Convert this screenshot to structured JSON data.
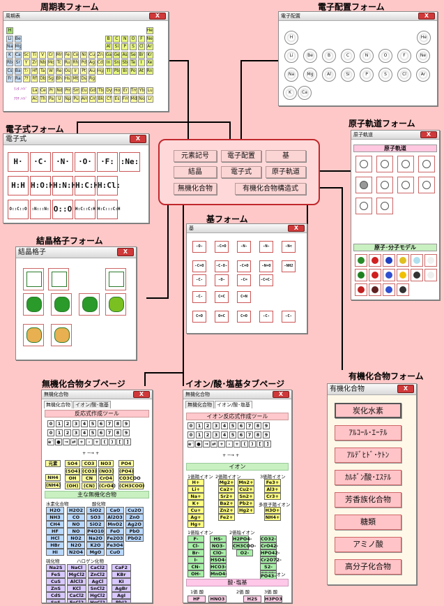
{
  "captions": {
    "periodic": "周期表フォーム",
    "econfig": "電子配置フォーム",
    "dot": "電子式フォーム",
    "orbital": "原子軌道フォーム",
    "crystal": "結晶格子フォーム",
    "group": "基フォーム",
    "inorganic": "無機化合物タブページ",
    "ion": "イオン/酸･塩基タブページ",
    "organic": "有機化合物フォーム"
  },
  "windows": {
    "periodic": "周期表",
    "econfig": "電子配置",
    "dot": "電子式",
    "orbital": "原子軌道",
    "crystal": "結晶格子",
    "group": "基",
    "inorganic": "無機化合物",
    "ion": "無機化合物",
    "organic": "有機化合物"
  },
  "close_label": "X",
  "hub": {
    "b1": "元素記号",
    "b2": "電子配置",
    "b3": "基",
    "b4": "結晶",
    "b5": "電子式",
    "b6": "原子軌道",
    "b7": "無機化合物",
    "b8": "有機化合物構造式"
  },
  "periodic": {
    "row1": [
      "H",
      "",
      "",
      "",
      "",
      "",
      "",
      "",
      "",
      "",
      "",
      "",
      "",
      "",
      "",
      "",
      "",
      "He"
    ],
    "row2": [
      "Li",
      "Be",
      "",
      "",
      "",
      "",
      "",
      "",
      "",
      "",
      "",
      "",
      "B",
      "C",
      "N",
      "O",
      "F",
      "Ne"
    ],
    "row3": [
      "Na",
      "Mg",
      "",
      "",
      "",
      "",
      "",
      "",
      "",
      "",
      "",
      "",
      "Al",
      "Si",
      "P",
      "S",
      "Cl",
      "Ar"
    ],
    "row4": [
      "K",
      "Ca",
      "Sc",
      "Ti",
      "V",
      "Cr",
      "Mn",
      "Fe",
      "Co",
      "Ni",
      "Cu",
      "Zn",
      "Ga",
      "Ge",
      "As",
      "Se",
      "Br",
      "Kr"
    ],
    "row5": [
      "Rb",
      "Sr",
      "Y",
      "Zr",
      "Nb",
      "Mo",
      "Tc",
      "Ru",
      "Rh",
      "Pd",
      "Ag",
      "Cd",
      "In",
      "Sn",
      "Sb",
      "Te",
      "I",
      "Xe"
    ],
    "row6": [
      "Cs",
      "Ba",
      "ﾗﾝﾀﾉｲﾄﾞ",
      "Hf",
      "Ta",
      "W",
      "Re",
      "Os",
      "Ir",
      "Pt",
      "Au",
      "Hg",
      "Tl",
      "Pb",
      "Bi",
      "Po",
      "At",
      "Rn"
    ],
    "row7": [
      "Fr",
      "Ra",
      "ｱｸﾁﾉｲﾄﾞ",
      "Rf",
      "Db",
      "Sg",
      "Bh",
      "Hs",
      "Mt",
      "Ds",
      "Rg",
      "",
      "",
      "",
      "",
      "",
      "",
      ""
    ],
    "lan": [
      "La",
      "Ce",
      "Pr",
      "Nd",
      "Pm",
      "Sm",
      "Eu",
      "Gd",
      "Tb",
      "Dy",
      "Ho",
      "Er",
      "Tm",
      "Yb",
      "Lu"
    ],
    "act": [
      "Ac",
      "Th",
      "Pa",
      "U",
      "Np",
      "Pu",
      "Am",
      "Cm",
      "Bk",
      "Cf",
      "Es",
      "Fm",
      "Md",
      "No",
      "Lr"
    ],
    "lan_label": "ﾗﾝﾀ\nﾉｲﾄﾞ",
    "act_label": "ｱｸﾁ\nﾉｲﾄﾞ"
  },
  "econfig": {
    "row1": [
      "H",
      "He"
    ],
    "row2": [
      "Li",
      "Be",
      "B",
      "C",
      "N",
      "O",
      "F",
      "Ne"
    ],
    "row3": [
      "Na",
      "Mg",
      "Al",
      "Si",
      "P",
      "S",
      "Cl",
      "Ar"
    ],
    "row4": [
      "K",
      "Ca"
    ]
  },
  "dot": {
    "r1": [
      "H·",
      "·C·",
      "·N·",
      "·O·",
      "·F:",
      ":Ne:"
    ],
    "r2": [
      "H:H",
      "H:O:H",
      "H:N:H",
      "H:C:H",
      "H:Cl:",
      ""
    ],
    "r3": [
      "O::C::O",
      ":N:::N:",
      "O::O",
      "H:C::C:H",
      "H:C:::C:H",
      ""
    ]
  },
  "orbital": {
    "sec1": "原子軌道",
    "sec2": "原子･分子モデル"
  },
  "group": {
    "r1": [
      "-O-",
      "-C=O",
      "-N-",
      "-N-",
      "-N<"
    ],
    "r2": [
      "-C=O",
      "-C-O-",
      "-C=O",
      "-N=O",
      "-NH2"
    ],
    "r3": [
      "-C-",
      "-O-",
      "-C=",
      "-C=C-",
      ""
    ],
    "r4": [
      "-C-",
      "C=C",
      "C=N",
      ""
    ],
    "r5": [
      "C=O",
      "O=C",
      "C=O",
      "-C-",
      "-C-"
    ]
  },
  "inorganic": {
    "tabs": [
      "無機化合物",
      "イオン/酸･塩基"
    ],
    "sec_tool": "反応式作成ツール",
    "digits": [
      "0",
      "1",
      "2",
      "3",
      "4",
      "5",
      "6",
      "7",
      "8",
      "9"
    ],
    "ops": [
      "e⁻",
      "●",
      "→",
      "⇄",
      "+",
      "-",
      "+",
      "(",
      ")",
      "[",
      "]"
    ],
    "arrow": "+ ─→ +",
    "blocks": [
      "元素",
      "SO4",
      "CO3",
      "NO3",
      "PO4",
      "(SO4)",
      "(CO3)",
      "(NO3)",
      "(PO4)",
      "NH4",
      "OH",
      "CN",
      "CrO4",
      "CO3COO",
      "(NH4)",
      "(OH)",
      "(CN)",
      "(CrO4)",
      "(CH3COO)"
    ],
    "sec_main": "主な無機化合物",
    "h_hyd": "水素化合物",
    "h_ox": "酸化物",
    "compounds_l": [
      "H2O",
      "NH3",
      "CH4",
      "HF",
      "HCl",
      "HBr",
      "HI"
    ],
    "compounds_m1": [
      "H2O2",
      "CO",
      "NO",
      "NO",
      "NO2",
      "N2O",
      "N2O4"
    ],
    "compounds_m2": [
      "SiO2",
      "SO3",
      "SiO2",
      "P4O10",
      "Na2O",
      "K2O",
      "MgO"
    ],
    "compounds_r1": [
      "CaO",
      "Al2O3",
      "MnO2",
      "FeO",
      "Fe2O3",
      "Fe3O4",
      "CuO"
    ],
    "compounds_r2": [
      "Cu2O",
      "ZnO",
      "Ag2O",
      "PbO",
      "PbO2",
      "",
      ""
    ],
    "h_sulf": "硫化物",
    "h_hal": "ハロゲン化物",
    "sulf": [
      "Na2S",
      "FeS",
      "CuS",
      "ZnS",
      "CdS",
      "SnS"
    ],
    "hal1": [
      "NaCl",
      "MgCl2",
      "AlCl3",
      "KCl",
      "CaCl2",
      "FeCl2"
    ],
    "hal2": [
      "CaCl2",
      "ZnCl2",
      "AgCl",
      "SnCl2",
      "HgCl2",
      "HgCl2"
    ],
    "hal3": [
      "CaF2",
      "KBr",
      "KI",
      "AgBr",
      "AgI",
      "PbI2"
    ]
  },
  "ion": {
    "tabs": [
      "無機化合物",
      "イオン/酸･塩基"
    ],
    "sec_tool": "イオン反応式作成ツール",
    "sec_ion": "イオン",
    "h1": "1価陽イオン",
    "h2": "2価陽イオン",
    "h3": "3価陽イオン",
    "c1": [
      "H+",
      "Li+",
      "Na+",
      "K+",
      "Cu+",
      "Ag+",
      "Hg+"
    ],
    "c2": [
      "Mg2+",
      "Ca2+",
      "Sr2+",
      "Ba2+",
      "Zn2+",
      "Fe2+"
    ],
    "c2b": [
      "Mn2+",
      "Cu2+",
      "Sn2+",
      "Pb2+",
      "Hg2+"
    ],
    "c3": [
      "Fe3+",
      "Al3+",
      "Cr3+"
    ],
    "h_multi": "多原子陽イオン",
    "multi": [
      "H3O+",
      "NH4+"
    ],
    "h_an1": "1価陰イオン",
    "h_an2": "2価陰イオン",
    "h_an3": "3価陰イオン",
    "an1": [
      "F-",
      "Cl-",
      "Br-",
      "I-",
      "CN-",
      "OH-"
    ],
    "an1b": [
      "HS-",
      "NO3-",
      "ClO-",
      "HSO4-",
      "HCO3-",
      "MnO4-"
    ],
    "an1c": [
      "H2PO4-",
      "CH3COO-",
      "",
      "",
      ""
    ],
    "an2": [
      "CO32-",
      "CrO42-",
      "HPO42-",
      "Cr2O72-",
      "S2-",
      "SO42-"
    ],
    "an2b": [
      "O2-",
      "",
      ""
    ],
    "an3": [
      "PO43-"
    ],
    "sec_acid": "酸･塩基",
    "h_a1": "1価 酸",
    "h_a2": "2価 酸",
    "h_a3": "3価 酸",
    "acids": [
      "HF",
      "HNO3",
      "H2S",
      "H3PO3"
    ]
  },
  "organic": {
    "buttons": [
      "炭化水素",
      "ｱﾙｺｰﾙ･ｴｰﾃﾙ",
      "ｱﾙﾃﾞﾋﾄﾞ･ｹﾄﾝ",
      "ｶﾙﾎﾞﾝ酸･ｴｽﾃﾙ",
      "芳香族化合物",
      "糖類",
      "アミノ酸",
      "高分子化合物"
    ]
  }
}
